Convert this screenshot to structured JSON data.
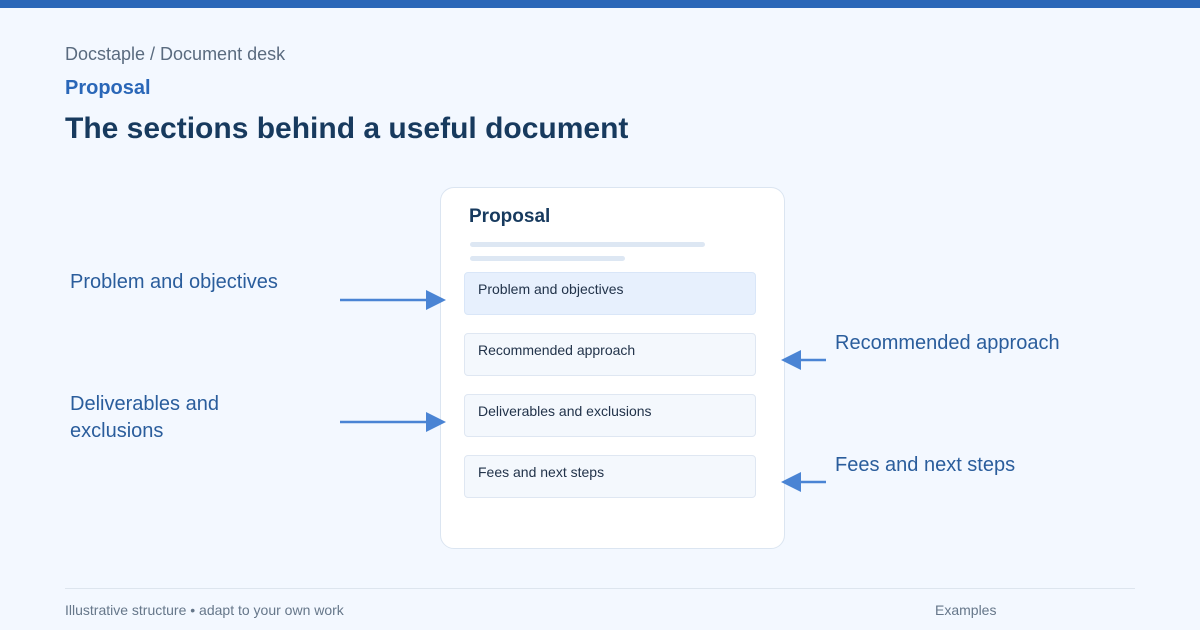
{
  "header": {
    "breadcrumb": "Docstaple / Document desk",
    "kicker": "Proposal",
    "title": "The sections behind a useful document"
  },
  "document": {
    "title": "Proposal",
    "sections": [
      "Problem and objectives",
      "Recommended approach",
      "Deliverables and exclusions",
      "Fees and next steps"
    ]
  },
  "callouts": {
    "left": [
      "Problem and objectives",
      "Deliverables and exclusions"
    ],
    "right": [
      "Recommended approach",
      "Fees and next steps"
    ]
  },
  "footer": {
    "note": "Illustrative structure • adapt to your own work",
    "link": "Examples"
  },
  "colors": {
    "accent": "#2a67b8",
    "arrow": "#4a84d4",
    "title": "#173a5e",
    "background": "#f3f8ff"
  }
}
